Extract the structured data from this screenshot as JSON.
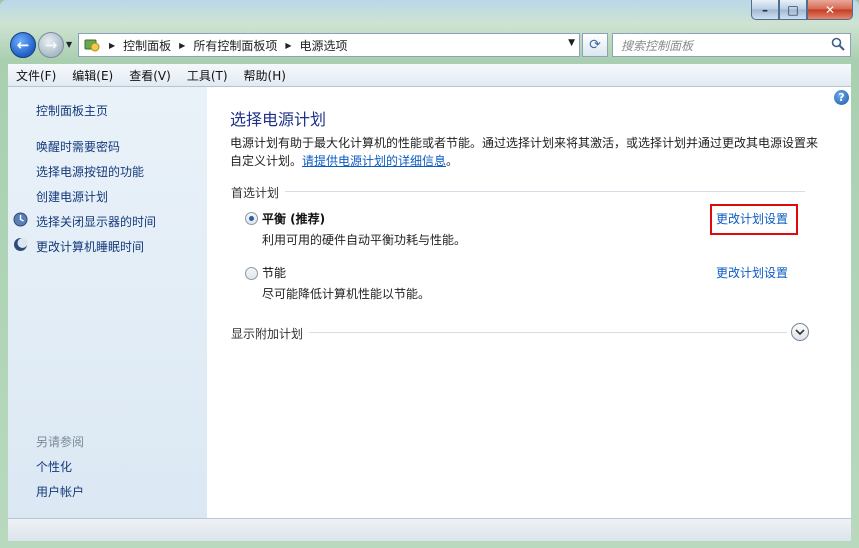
{
  "window": {
    "minimize": "–",
    "maximize": "□",
    "close": "✕"
  },
  "nav": {
    "back_label": "←",
    "forward_label": "→",
    "breadcrumb": [
      "控制面板",
      "所有控制面板项",
      "电源选项"
    ],
    "search_placeholder": "搜索控制面板"
  },
  "menu": [
    "文件(F)",
    "编辑(E)",
    "查看(V)",
    "工具(T)",
    "帮助(H)"
  ],
  "sidebar": {
    "home": "控制面板主页",
    "links": [
      "唤醒时需要密码",
      "选择电源按钮的功能",
      "创建电源计划",
      "选择关闭显示器的时间",
      "更改计算机睡眠时间"
    ],
    "see_also_title": "另请参阅",
    "see_also": [
      "个性化",
      "用户帐户"
    ]
  },
  "main": {
    "title": "选择电源计划",
    "description": "电源计划有助于最大化计算机的性能或者节能。通过选择计划来将其激活，或选择计划并通过更改其电源设置来自定义计划。",
    "more_info_link": "请提供电源计划的详细信息",
    "preferred_label": "首选计划",
    "plans": [
      {
        "name": "平衡 (推荐)",
        "desc": "利用可用的硬件自动平衡功耗与性能。",
        "link": "更改计划设置",
        "selected": true
      },
      {
        "name": "节能",
        "desc": "尽可能降低计算机性能以节能。",
        "link": "更改计划设置",
        "selected": false
      }
    ],
    "additional_label": "显示附加计划"
  },
  "colors": {
    "link": "#0b5bc2",
    "title": "#1e3287",
    "highlight": "#e00a0a"
  }
}
